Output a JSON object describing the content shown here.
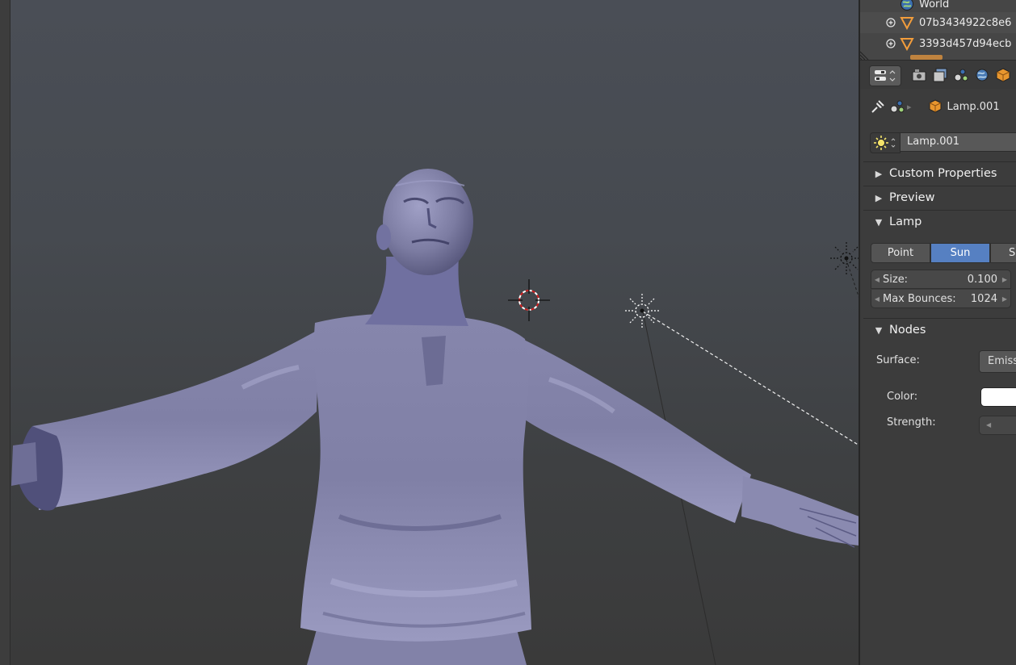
{
  "viewport": {
    "background_top": "#4a4e56",
    "background_bottom": "#3a3a3a",
    "model_color": "#7a7aa0",
    "objects": [
      "3d-cursor",
      "sun-lamp",
      "character-mesh"
    ]
  },
  "outliner": {
    "rows": [
      {
        "label": "World",
        "icon": "world-icon"
      },
      {
        "label": "07b3434922c8e6",
        "icon": "mesh-triangle-icon"
      },
      {
        "label": "3393d457d94ecb",
        "icon": "mesh-triangle-icon"
      }
    ]
  },
  "properties": {
    "context_tabs": [
      "render-tab-icon",
      "render-layers-tab-icon",
      "scene-tab-icon",
      "world-tab-icon",
      "object-tab-icon"
    ],
    "breadcrumb": {
      "object_name": "Lamp.001"
    },
    "datablock": {
      "name": "Lamp.001"
    },
    "panels": {
      "custom_properties": "Custom Properties",
      "preview": "Preview",
      "lamp": "Lamp",
      "nodes": "Nodes"
    },
    "lamp_types": {
      "point": "Point",
      "sun": "Sun",
      "spot": "Sp",
      "active": "Sun"
    },
    "size": {
      "label": "Size:",
      "value": "0.100"
    },
    "max_bounces": {
      "label": "Max Bounces:",
      "value": "1024"
    },
    "surface": {
      "label": "Surface:",
      "value": "Emission"
    },
    "color": {
      "label": "Color:",
      "value": "#ffffff"
    },
    "strength": {
      "label": "Strength:"
    },
    "accent": "#5680c2"
  }
}
